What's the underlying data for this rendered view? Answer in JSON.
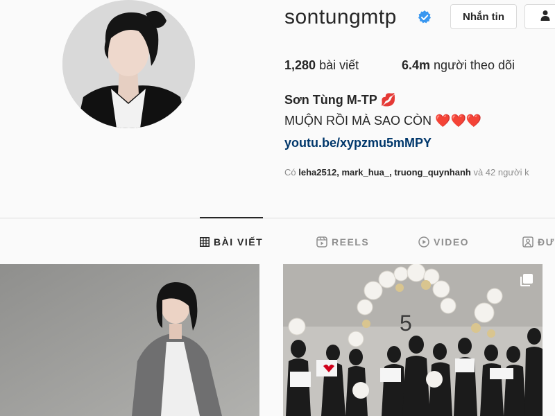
{
  "profile": {
    "username": "sontungmtp",
    "message_button": "Nhắn tin",
    "posts_count": "1,280",
    "posts_label": "bài viết",
    "followers_count": "6.4m",
    "followers_label": "người theo dõi",
    "full_name": "Sơn Tùng M-TP",
    "name_emoji": "💋",
    "bio": "MUỘN RỒI MÀ SAO CÒN",
    "bio_emoji": "❤️❤️❤️",
    "link": "youtu.be/xypzmu5mMPY",
    "mutual_prefix": "Có",
    "mutual_name_1": "leha2512",
    "mutual_sep_1": ",",
    "mutual_name_2": "mark_hua_",
    "mutual_sep_2": ",",
    "mutual_name_3": "truong_quynhanh",
    "mutual_suffix": "và 42 người k"
  },
  "tabs": {
    "posts": "BÀI VIẾT",
    "reels": "REELS",
    "video": "VIDEO",
    "tagged": "ĐƯ"
  },
  "icons": {
    "verified": "verified-badge-icon",
    "follow": "person-icon",
    "posts": "grid-icon",
    "reels": "reels-icon",
    "video": "play-circle-icon",
    "tagged": "tag-person-icon",
    "multi": "multiple-images-icon"
  },
  "colors": {
    "verified": "#3897f0",
    "link": "#00376b",
    "muted": "#8e8e8e",
    "text": "#262626"
  }
}
